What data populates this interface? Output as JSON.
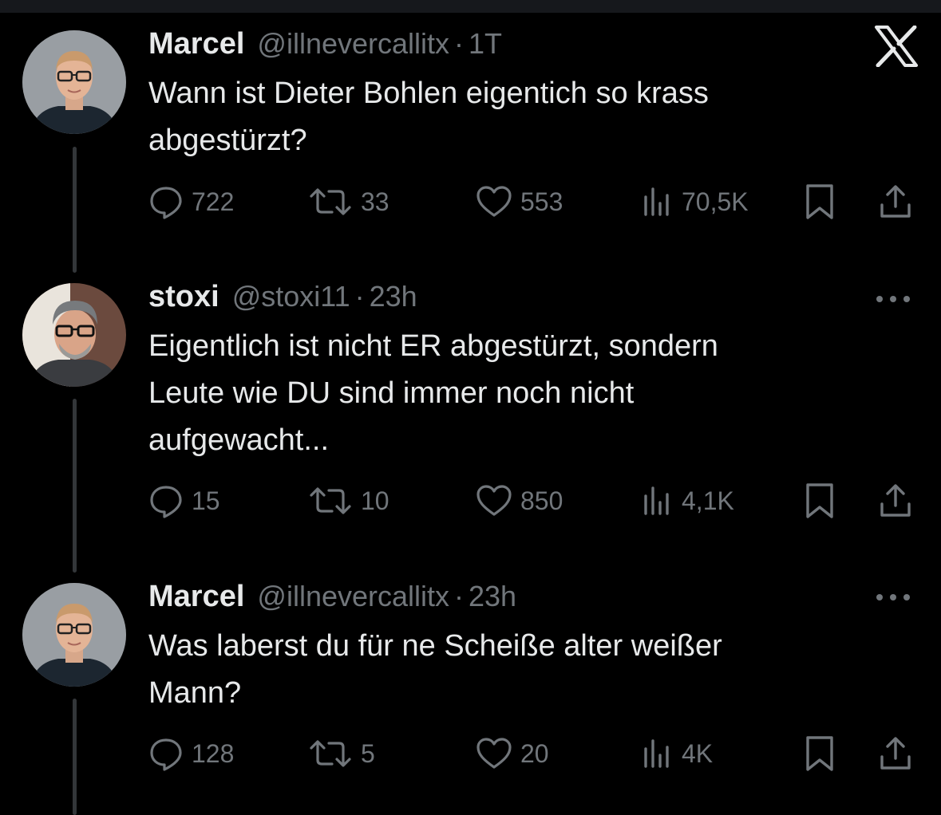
{
  "app": {
    "logo_icon": "x-logo-icon"
  },
  "tweets": [
    {
      "name": "Marcel",
      "handle": "@illnevercallitx",
      "time": "1T",
      "text_lines": [
        "Wann ist Dieter Bohlen eigentich so krass",
        "abgestürzt?"
      ],
      "replies": "722",
      "retweets": "33",
      "likes": "553",
      "views": "70,5K"
    },
    {
      "name": "stoxi",
      "handle": "@stoxi11",
      "time": "23h",
      "text_lines": [
        "Eigentlich ist nicht ER abgestürzt, sondern",
        "Leute wie DU sind immer noch nicht",
        "aufgewacht..."
      ],
      "replies": "15",
      "retweets": "10",
      "likes": "850",
      "views": "4,1K"
    },
    {
      "name": "Marcel",
      "handle": "@illnevercallitx",
      "time": "23h",
      "text_lines": [
        "Was laberst du für ne Scheiße alter weißer",
        "Mann?"
      ],
      "replies": "128",
      "retweets": "5",
      "likes": "20",
      "views": "4K"
    }
  ]
}
